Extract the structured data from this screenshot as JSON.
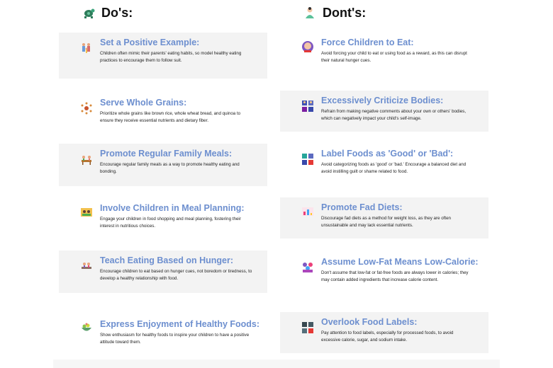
{
  "dos": {
    "heading": "Do's:",
    "icon": "turtle-icon",
    "items": [
      {
        "title": "Set a Positive Example:",
        "desc": "Children often mimic their parents' eating habits, so model healthy eating practices to encourage them to follow suit.",
        "icon": "family-icon"
      },
      {
        "title": "Serve Whole Grains:",
        "desc": "Prioritize whole grains like brown rice, whole wheat bread, and quinoa to ensure they receive essential nutrients and dietary fiber.",
        "icon": "grains-icon"
      },
      {
        "title": "Promote Regular Family Meals:",
        "desc": "Encourage regular family meals as a way to promote healthy eating and bonding.",
        "icon": "family-meal-icon"
      },
      {
        "title": "Involve Children in Meal Planning:",
        "desc": "Engage your children in food shopping and meal planning, fostering their interest in nutritious choices.",
        "icon": "meal-planning-icon"
      },
      {
        "title": "Teach Eating Based on Hunger:",
        "desc": "Encourage children to eat based on hunger cues, not boredom or tiredness, to develop a healthy relationship with food.",
        "icon": "hunger-icon"
      },
      {
        "title": "Express Enjoyment of Healthy Foods:",
        "desc": "Show enthusiasm for healthy foods to inspire your children to have a positive attitude toward them.",
        "icon": "salad-bowl-icon"
      }
    ]
  },
  "donts": {
    "heading": "Dont's:",
    "icon": "person-icon",
    "items": [
      {
        "title": "Force Children to Eat:",
        "desc": "Avoid forcing your child to eat or using food as a reward, as this can disrupt their natural hunger cues.",
        "icon": "child-face-icon"
      },
      {
        "title": "Excessively Criticize Bodies:",
        "desc": "Refrain from making negative comments about your own or others' bodies, which can negatively impact your child's self-image.",
        "icon": "bodies-grid-icon"
      },
      {
        "title": "Label Foods as 'Good' or 'Bad':",
        "desc": "Avoid categorizing foods as 'good' or 'bad.' Encourage a balanced diet and avoid instilling guilt or shame related to food.",
        "icon": "food-labels-icon"
      },
      {
        "title": "Promote Fad Diets:",
        "desc": "Discourage fad diets as a method for weight loss, as they are often unsustainable and may lack essential nutrients.",
        "icon": "diet-chart-icon"
      },
      {
        "title": "Assume Low-Fat Means Low-Calorie:",
        "desc": "Don't assume that low-fat or fat-free foods are always lower in calories; they may contain added ingredients that increase calorie content.",
        "icon": "group-icon"
      },
      {
        "title": "Overlook Food Labels:",
        "desc": "Pay attention to food labels, especially for processed foods, to avoid excessive calorie, sugar, and sodium intake.",
        "icon": "label-grid-icon"
      }
    ]
  }
}
